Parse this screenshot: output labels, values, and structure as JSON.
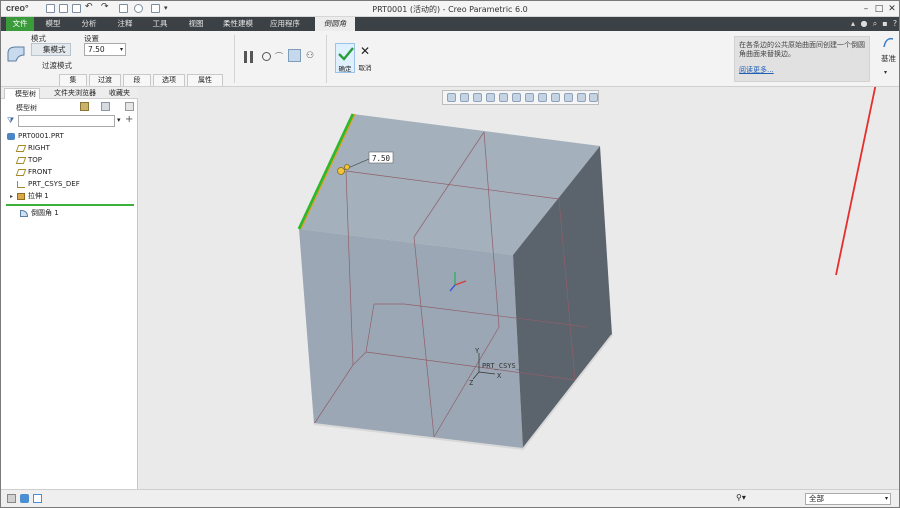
{
  "app": {
    "logo": "creo°",
    "window_title": "PRT0001 (活动的) - Creo Parametric 6.0"
  },
  "menu": {
    "tabs": [
      "文件",
      "模型",
      "分析",
      "注释",
      "工具",
      "视图",
      "柔性建模",
      "应用程序"
    ],
    "active_tab": "倒圆角"
  },
  "ribbon": {
    "mode_label": "模式",
    "set_mode": "集模式",
    "transition_mode": "过渡模式",
    "settings_label": "设置",
    "radius_value": "7.50",
    "ok_label": "确定",
    "cancel_label": "取消",
    "subtabs": [
      "集",
      "过渡",
      "段",
      "选项",
      "属性"
    ],
    "help_text": "在各条边的公共原始曲面间创建一个倒圆角曲面来替换边。",
    "help_link": "阅读更多...",
    "datum_label": "基准"
  },
  "panel": {
    "tabs": [
      "模型树",
      "文件夹浏览器",
      "收藏夹"
    ],
    "header": "模型树",
    "items": [
      "PRT0001.PRT",
      "RIGHT",
      "TOP",
      "FRONT",
      "PRT_CSYS_DEF",
      "拉伸 1"
    ],
    "insert_item": "倒圆角 1"
  },
  "graphics": {
    "dimension_value": "7.50",
    "csys_label": "PRT_CSYS_",
    "axis_x": "X",
    "axis_y": "Y",
    "axis_z": "Z"
  },
  "status": {
    "filter_value": "全部"
  },
  "colors": {
    "file_tab": "#3a9b3a",
    "menubar": "#3c4146",
    "model_face_top": "#a7b3bf",
    "model_face_front": "#9aa6b3",
    "model_face_side": "#5b636d",
    "edge_highlight": "#2eb82e",
    "annotation_arrow": "#e52e2e"
  }
}
